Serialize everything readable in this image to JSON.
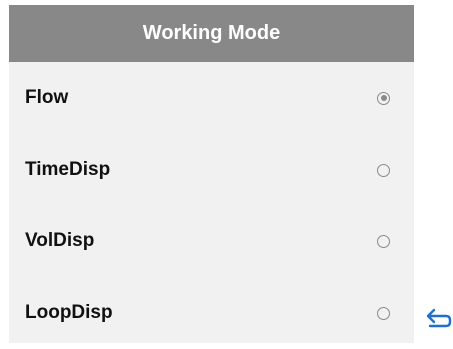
{
  "header": {
    "title": "Working Mode"
  },
  "options": [
    {
      "label": "Flow",
      "selected": true
    },
    {
      "label": "TimeDisp",
      "selected": false
    },
    {
      "label": "VolDisp",
      "selected": false
    },
    {
      "label": "LoopDisp",
      "selected": false
    }
  ],
  "colors": {
    "header_bg": "#888888",
    "panel_bg": "#f1f1f1",
    "accent": "#1e6fd0"
  },
  "icons": {
    "back": "back-arrow-icon"
  }
}
